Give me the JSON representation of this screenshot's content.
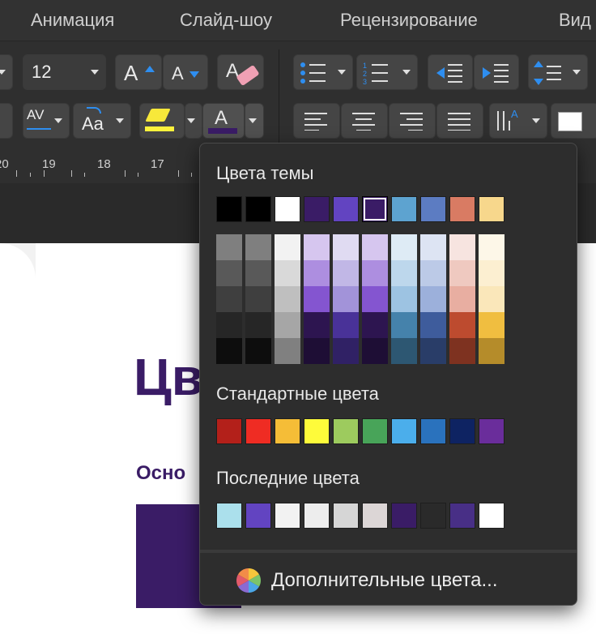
{
  "tabs": [
    "Анимация",
    "Слайд-шоу",
    "Рецензирование",
    "Вид"
  ],
  "toolbar": {
    "font_size": "12",
    "grow_font": "A",
    "shrink_font": "A",
    "char_spacing": "AV",
    "change_case": "Aa",
    "font_color_letter": "A",
    "numbered_list": "123"
  },
  "ruler": [
    "20",
    "19",
    "18",
    "17"
  ],
  "document": {
    "heading": "Цв",
    "subheading": "Осно"
  },
  "color_menu": {
    "theme_title": "Цвета темы",
    "standard_title": "Стандартные цвета",
    "recent_title": "Последние цвета",
    "more_colors": "Дополнительные цвета...",
    "theme_colors": [
      "#000000",
      "#000000",
      "#ffffff",
      "#3a1c66",
      "#6244c1",
      "#3a1c66",
      "#5da3d0",
      "#5c7cc2",
      "#d97b63",
      "#f7d78c"
    ],
    "selected_index": 5,
    "theme_shades": [
      [
        "#7f7f7f",
        "#595959",
        "#3f3f3f",
        "#262626",
        "#0d0d0d"
      ],
      [
        "#7f7f7f",
        "#595959",
        "#3f3f3f",
        "#262626",
        "#0d0d0d"
      ],
      [
        "#f2f2f2",
        "#d9d9d9",
        "#bfbfbf",
        "#a6a6a6",
        "#808080"
      ],
      [
        "#d6c6ef",
        "#ad8ee0",
        "#8455d0",
        "#2d1550",
        "#1e0e35"
      ],
      [
        "#e0dbf2",
        "#c1b7e6",
        "#a293d9",
        "#493298",
        "#302165"
      ],
      [
        "#d6c6ef",
        "#ad8ee0",
        "#8455d0",
        "#2d1550",
        "#1e0e35"
      ],
      [
        "#deebf5",
        "#bdd7ec",
        "#9dc3e2",
        "#4582ab",
        "#2d5772"
      ],
      [
        "#dde4f3",
        "#bccae7",
        "#9cb0db",
        "#3e5c9c",
        "#293d68"
      ],
      [
        "#f7e4e0",
        "#efc9c0",
        "#e8aea1",
        "#bd4b2f",
        "#7e3220"
      ],
      [
        "#fdf7e8",
        "#fcefd1",
        "#fae7ba",
        "#f0be40",
        "#b58c2a"
      ]
    ],
    "standard_colors": [
      "#b3201a",
      "#ef2c23",
      "#f5bd37",
      "#fefb3a",
      "#9dcb5e",
      "#48a459",
      "#4baeeb",
      "#2a72bd",
      "#0e2362",
      "#6a2d9b"
    ],
    "recent_colors": [
      "#abe0ec",
      "#6244c1",
      "#f2f2f2",
      "#ededed",
      "#d6d6d6",
      "#dcd6d6",
      "#3a1c66",
      "#2a2a2a",
      "#482f86",
      "#ffffff"
    ]
  }
}
